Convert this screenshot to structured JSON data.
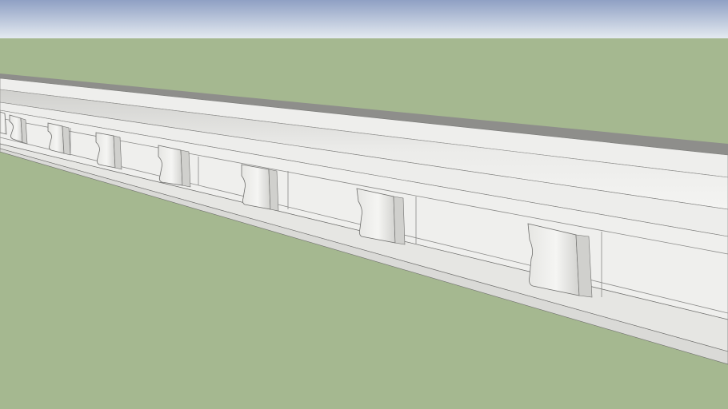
{
  "scene": {
    "description_hidden": "",
    "colors": {
      "sky_top": "#8fa0c4",
      "sky_bottom": "#dfe6ee",
      "ground": "#a5b890",
      "molding_light": "#f1f1ef",
      "molding_mid": "#e2e2df",
      "molding_shadow": "#c9c9c6",
      "molding_dark": "#8e8e8b",
      "edge_line": "#6f6f6d"
    },
    "objects": [
      {
        "name": "cornice-molding",
        "type": "3d-model"
      }
    ]
  }
}
